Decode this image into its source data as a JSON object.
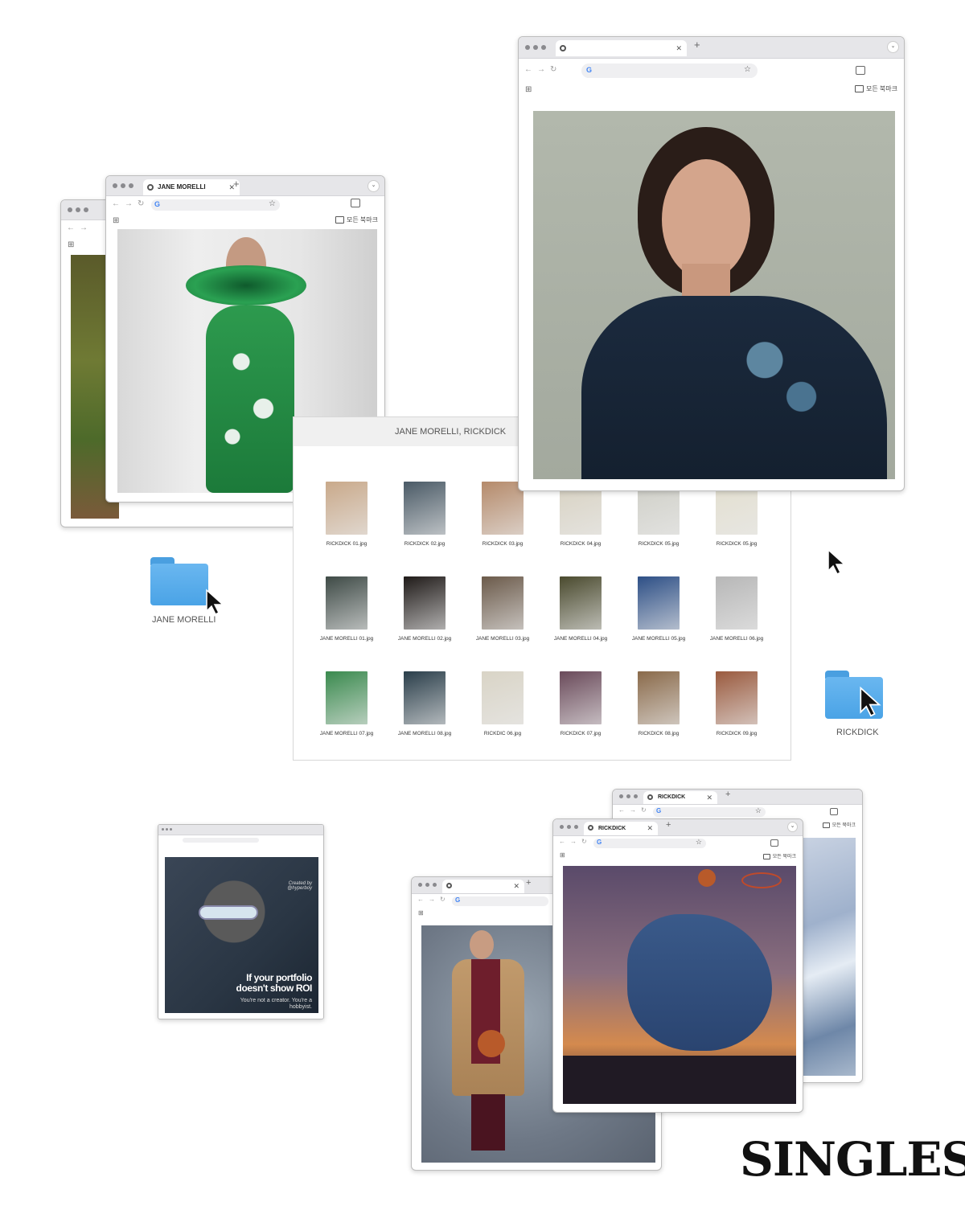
{
  "brand": {
    "logo": "SINGLES"
  },
  "browser": {
    "bookmarks_label": "모든 북마크",
    "new_tab_symbol": "+",
    "close_symbol": "✕"
  },
  "windows": {
    "portrait": {
      "tab_title": ""
    },
    "jane_green": {
      "tab_title": "JANE MORELLI"
    },
    "back_left": {
      "tab_title": ""
    },
    "small_ad": {
      "tab_title": "",
      "ad_credit": "Created by @hyperboy",
      "ad_headline": "If your portfolio doesn't show ROI",
      "ad_sub": "You're not a creator. You're a hobbyist."
    },
    "coat": {
      "tab_title": ""
    },
    "dunk": {
      "tab_title": "RICKDICK"
    },
    "back_right": {
      "tab_title": "RICKDICK"
    }
  },
  "file_browser": {
    "title": "JANE MORELLI, RICKDICK",
    "files": [
      {
        "name": "RICKDICK 01.jpg",
        "color": "#c9a98a"
      },
      {
        "name": "RICKDICK 02.jpg",
        "color": "#4a5a66"
      },
      {
        "name": "RICKDICK 03.jpg",
        "color": "#b58a6a"
      },
      {
        "name": "RICKDICK 04.jpg",
        "color": "#d8d2c2"
      },
      {
        "name": "RICKDICK 05.jpg",
        "color": "#cfcfc7"
      },
      {
        "name": "RICKDICK 05.jpg",
        "color": "#e3dfcf"
      },
      {
        "name": "JANE MORELLI 01.jpg",
        "color": "#3e4a46"
      },
      {
        "name": "JANE MORELLI 02.jpg",
        "color": "#1f1a18"
      },
      {
        "name": "JANE MORELLI 03.jpg",
        "color": "#6b5a4a"
      },
      {
        "name": "JANE MORELLI 04.jpg",
        "color": "#4a4a2e"
      },
      {
        "name": "JANE MORELLI 05.jpg",
        "color": "#2d4f86"
      },
      {
        "name": "JANE MORELLI 06.jpg",
        "color": "#b7b7b7"
      },
      {
        "name": "JANE MORELLI 07.jpg",
        "color": "#3a8a4e"
      },
      {
        "name": "JANE MORELLI 08.jpg",
        "color": "#2a3e4a"
      },
      {
        "name": "RICKDIC 06.jpg",
        "color": "#d9d4c6"
      },
      {
        "name": "RICKDICK 07.jpg",
        "color": "#6a4a5a"
      },
      {
        "name": "RICKDICK 08.jpg",
        "color": "#8a6a4a"
      },
      {
        "name": "RICKDICK 09.jpg",
        "color": "#9a5a3e"
      }
    ]
  },
  "folders": [
    {
      "name": "JANE MORELLI",
      "color": "#4aa3e6"
    },
    {
      "name": "RICKDICK",
      "color": "#4aa3e6"
    }
  ]
}
